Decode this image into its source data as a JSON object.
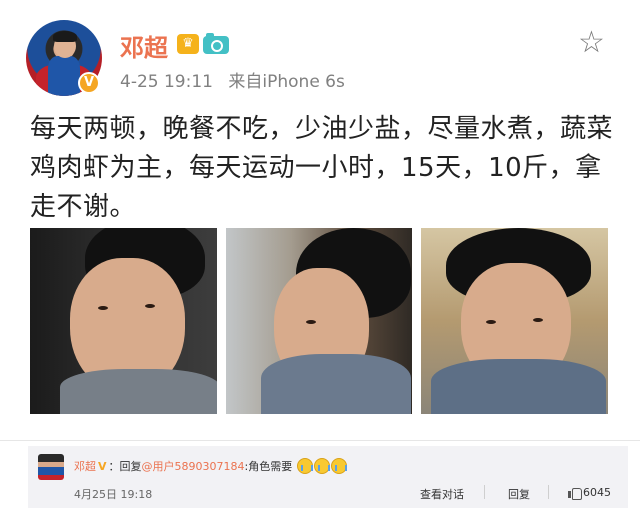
{
  "post": {
    "author": "邓超",
    "timestamp": "4-25 19:11",
    "source": "来自iPhone 6s",
    "body": "每天两顿，晚餐不吃，少油少盐，尽量水煮，蔬菜鸡肉虾为主，每天运动一小时，15天，10斤，拿走不谢。",
    "icons": {
      "favorite": "star-outline-icon",
      "badge": "verified-v-badge",
      "member": "crown-icon",
      "photo": "camera-icon"
    },
    "photo_count": 3
  },
  "comment": {
    "author": "邓超",
    "verified_mark": "V",
    "reply_prefix": "：回复",
    "mention": "@用户5890307184",
    "text": ":角色需要",
    "emoji_count": 3,
    "timestamp": "4月25日 19:18",
    "actions": {
      "view_conversation": "查看对话",
      "reply": "回复",
      "like_count": "6045"
    }
  },
  "colors": {
    "name": "#eb7350",
    "meta": "#808080",
    "badge": "#f5a623",
    "comment_bg": "#f2f2f5"
  }
}
